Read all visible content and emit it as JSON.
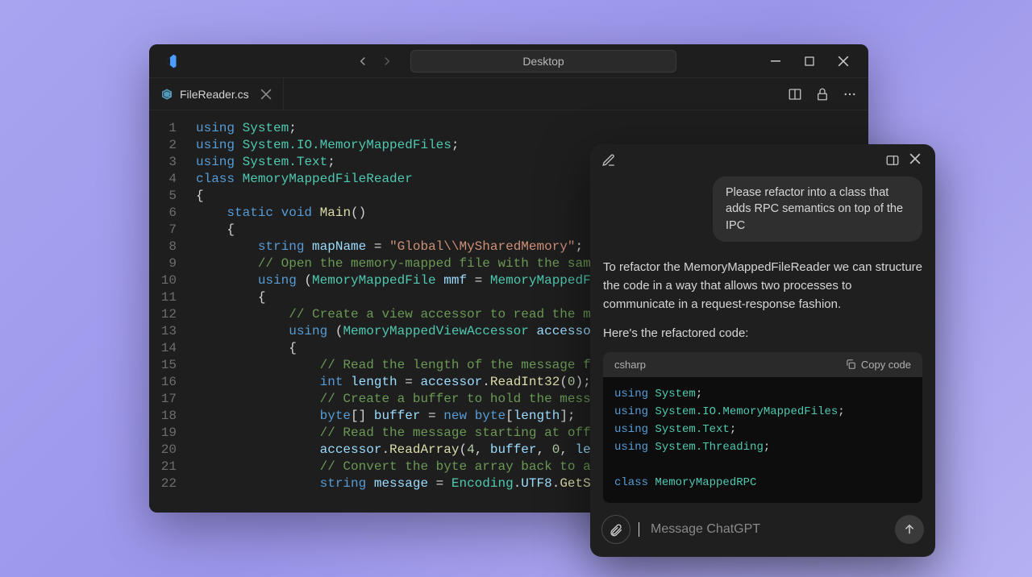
{
  "vscode": {
    "title": "Desktop",
    "tab": {
      "filename": "FileReader.cs"
    },
    "code_lines": [
      [
        [
          "kw",
          "using"
        ],
        [
          "punct",
          " "
        ],
        [
          "type",
          "System"
        ],
        [
          "punct",
          ";"
        ]
      ],
      [
        [
          "kw",
          "using"
        ],
        [
          "punct",
          " "
        ],
        [
          "type",
          "System.IO.MemoryMappedFiles"
        ],
        [
          "punct",
          ";"
        ]
      ],
      [
        [
          "kw",
          "using"
        ],
        [
          "punct",
          " "
        ],
        [
          "type",
          "System.Text"
        ],
        [
          "punct",
          ";"
        ]
      ],
      [
        [
          "kw",
          "class"
        ],
        [
          "punct",
          " "
        ],
        [
          "type",
          "MemoryMappedFileReader"
        ]
      ],
      [
        [
          "punct",
          "{"
        ]
      ],
      [
        [
          "punct",
          "    "
        ],
        [
          "kw",
          "static"
        ],
        [
          "punct",
          " "
        ],
        [
          "kw",
          "void"
        ],
        [
          "punct",
          " "
        ],
        [
          "fn",
          "Main"
        ],
        [
          "punct",
          "()"
        ]
      ],
      [
        [
          "punct",
          "    {"
        ]
      ],
      [
        [
          "punct",
          "        "
        ],
        [
          "kw",
          "string"
        ],
        [
          "punct",
          " "
        ],
        [
          "var",
          "mapName"
        ],
        [
          "punct",
          " = "
        ],
        [
          "str",
          "\"Global\\\\MySharedMemory\""
        ],
        [
          "punct",
          ";"
        ]
      ],
      [
        [
          "punct",
          "        "
        ],
        [
          "cmt",
          "// Open the memory-mapped file with the same na"
        ]
      ],
      [
        [
          "punct",
          "        "
        ],
        [
          "kw",
          "using"
        ],
        [
          "punct",
          " ("
        ],
        [
          "type",
          "MemoryMappedFile"
        ],
        [
          "punct",
          " "
        ],
        [
          "var",
          "mmf"
        ],
        [
          "punct",
          " = "
        ],
        [
          "type",
          "MemoryMappedFile"
        ],
        [
          "punct",
          "."
        ]
      ],
      [
        [
          "punct",
          "        {"
        ]
      ],
      [
        [
          "punct",
          "            "
        ],
        [
          "cmt",
          "// Create a view accessor to read the memor"
        ]
      ],
      [
        [
          "punct",
          "            "
        ],
        [
          "kw",
          "using"
        ],
        [
          "punct",
          " ("
        ],
        [
          "type",
          "MemoryMappedViewAccessor"
        ],
        [
          "punct",
          " "
        ],
        [
          "var",
          "accessor"
        ],
        [
          "punct",
          " = "
        ]
      ],
      [
        [
          "punct",
          "            {"
        ]
      ],
      [
        [
          "punct",
          "                "
        ],
        [
          "cmt",
          "// Read the length of the message first"
        ]
      ],
      [
        [
          "punct",
          "                "
        ],
        [
          "kw",
          "int"
        ],
        [
          "punct",
          " "
        ],
        [
          "var",
          "length"
        ],
        [
          "punct",
          " = "
        ],
        [
          "var",
          "accessor"
        ],
        [
          "punct",
          "."
        ],
        [
          "fn",
          "ReadInt32"
        ],
        [
          "punct",
          "("
        ],
        [
          "num",
          "0"
        ],
        [
          "punct",
          ");"
        ]
      ],
      [
        [
          "punct",
          "                "
        ],
        [
          "cmt",
          "// Create a buffer to hold the message"
        ]
      ],
      [
        [
          "punct",
          "                "
        ],
        [
          "kw",
          "byte"
        ],
        [
          "punct",
          "[] "
        ],
        [
          "var",
          "buffer"
        ],
        [
          "punct",
          " = "
        ],
        [
          "kw",
          "new"
        ],
        [
          "punct",
          " "
        ],
        [
          "kw",
          "byte"
        ],
        [
          "punct",
          "["
        ],
        [
          "var",
          "length"
        ],
        [
          "punct",
          "];"
        ]
      ],
      [
        [
          "punct",
          "                "
        ],
        [
          "cmt",
          "// Read the message starting at offset "
        ]
      ],
      [
        [
          "punct",
          "                "
        ],
        [
          "var",
          "accessor"
        ],
        [
          "punct",
          "."
        ],
        [
          "fn",
          "ReadArray"
        ],
        [
          "punct",
          "("
        ],
        [
          "num",
          "4"
        ],
        [
          "punct",
          ", "
        ],
        [
          "var",
          "buffer"
        ],
        [
          "punct",
          ", "
        ],
        [
          "num",
          "0"
        ],
        [
          "punct",
          ", "
        ],
        [
          "var",
          "length"
        ]
      ],
      [
        [
          "punct",
          "                "
        ],
        [
          "cmt",
          "// Convert the byte array back to a str"
        ]
      ],
      [
        [
          "punct",
          "                "
        ],
        [
          "kw",
          "string"
        ],
        [
          "punct",
          " "
        ],
        [
          "var",
          "message"
        ],
        [
          "punct",
          " = "
        ],
        [
          "type",
          "Encoding"
        ],
        [
          "punct",
          "."
        ],
        [
          "var",
          "UTF8"
        ],
        [
          "punct",
          "."
        ],
        [
          "fn",
          "GetStrin"
        ]
      ]
    ]
  },
  "chat": {
    "user_message": "Please refactor into a class that adds RPC semantics on top of the IPC",
    "assistant_para1": "To refactor the MemoryMappedFileReader we can structure the code in a way that allows two processes to communicate in a request-response fashion.",
    "assistant_para2": "Here's the refactored code:",
    "code_lang": "csharp",
    "copy_label": "Copy code",
    "code_lines": [
      [
        [
          "kw",
          "using"
        ],
        [
          "punct",
          " "
        ],
        [
          "type",
          "System"
        ],
        [
          "punct",
          ";"
        ]
      ],
      [
        [
          "kw",
          "using"
        ],
        [
          "punct",
          " "
        ],
        [
          "type",
          "System.IO.MemoryMappedFiles"
        ],
        [
          "punct",
          ";"
        ]
      ],
      [
        [
          "kw",
          "using"
        ],
        [
          "punct",
          " "
        ],
        [
          "type",
          "System.Text"
        ],
        [
          "punct",
          ";"
        ]
      ],
      [
        [
          "kw",
          "using"
        ],
        [
          "punct",
          " "
        ],
        [
          "type",
          "System.Threading"
        ],
        [
          "punct",
          ";"
        ]
      ],
      [
        [
          "punct",
          " "
        ]
      ],
      [
        [
          "kw",
          "class"
        ],
        [
          "punct",
          " "
        ],
        [
          "type",
          "MemoryMappedRPC"
        ]
      ]
    ],
    "input_placeholder": "Message ChatGPT"
  }
}
